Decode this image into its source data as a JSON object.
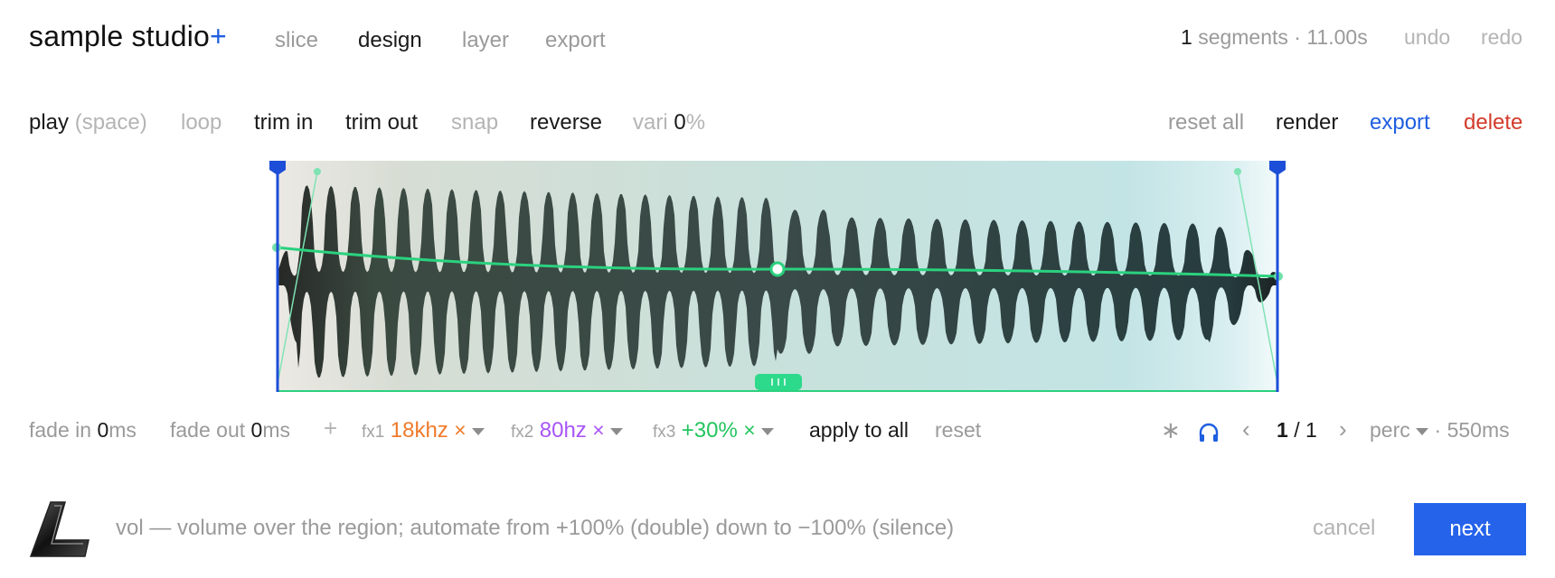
{
  "app": {
    "brand": "sample studio",
    "brand_plus": "+"
  },
  "nav": {
    "tabs": [
      {
        "label": "slice",
        "active": false
      },
      {
        "label": "design",
        "active": true
      },
      {
        "label": "layer",
        "active": false
      },
      {
        "label": "export",
        "active": false
      }
    ]
  },
  "header": {
    "segments_count": "1",
    "segments_text": "segments · 11.00s",
    "undo": "undo",
    "redo": "redo"
  },
  "toolbar": {
    "play": "play",
    "play_shortcut": "(space)",
    "loop": "loop",
    "trim_in": "trim in",
    "trim_out": "trim out",
    "snap": "snap",
    "reverse": "reverse",
    "vari_label": "vari",
    "vari_value": "0",
    "vari_unit": "%",
    "reset_all": "reset all",
    "render": "render",
    "export": "export",
    "delete": "delete"
  },
  "controls": {
    "fade_in_label": "fade in",
    "fade_in_value": "0",
    "fade_in_unit": "ms",
    "fade_out_label": "fade out",
    "fade_out_value": "0",
    "fade_out_unit": "ms",
    "add": "+",
    "fx": [
      {
        "label": "fx1",
        "value": "18khz",
        "color": "#f07a2b"
      },
      {
        "label": "fx2",
        "value": "80hz",
        "color": "#a855f7"
      },
      {
        "label": "fx3",
        "value": "+30%",
        "color": "#22c55e"
      }
    ],
    "remove_glyph": "×",
    "apply_to_all": "apply to all",
    "reset": "reset",
    "asterisk": "∗",
    "page_current": "1",
    "page_sep": "/",
    "page_total": "1",
    "prev": "‹",
    "next": "›",
    "mode": "perc",
    "duration": "· 550ms"
  },
  "footer": {
    "hint": "vol — volume over the region; automate from +100% (double) down to −100% (silence)",
    "cancel": "cancel",
    "next": "next"
  },
  "colors": {
    "accent": "#1f5fe0",
    "envelope": "#2bd17e",
    "danger": "#d23b2b",
    "marker": "#1d4ed8"
  }
}
